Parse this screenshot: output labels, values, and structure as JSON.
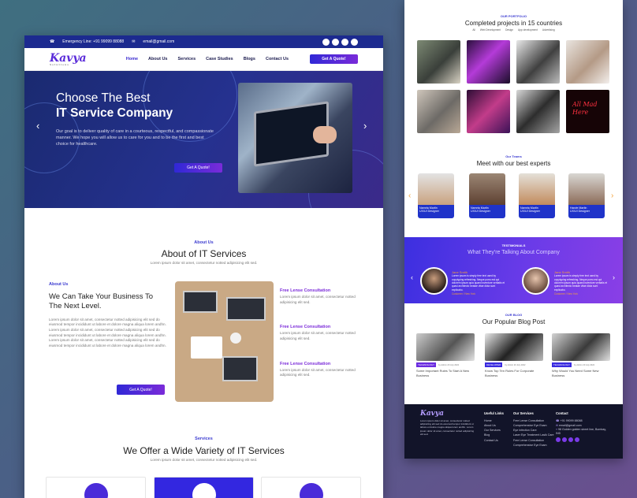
{
  "topbar": {
    "phone": "Emergency Line: +91 99099 88088",
    "email": "email@gmail.com"
  },
  "brand": {
    "name": "Kavya",
    "tagline": "Solutions"
  },
  "nav": {
    "items": [
      "Home",
      "About Us",
      "Services",
      "Case Studies",
      "Blogs",
      "Contact Us"
    ],
    "cta": "Get A Quote!"
  },
  "hero": {
    "line1": "Choose The Best",
    "line2": "IT Service Company",
    "body": "Our goal is to deliver quality of care in a courteous, respectful, and compassionate manner. We hope you will allow us to care for you and to be the first and best choice for healthcare.",
    "cta": "Get A Quote!"
  },
  "about": {
    "kicker": "About Us",
    "title": "About of IT Services",
    "sub": "Lorem ipsum dolor sit amet, consectetur notted adipisicing elit sed.",
    "label": "About Us",
    "heading": "We Can Take Your Business To The Next Level.",
    "para": "Lorem ipsum dolor sit amet, consectetur notted adipisicing elit sed do eiusmod tempor incididunt ut labore et dolore magna aliqua lorem andhn.",
    "para2": "Lorem ipsum dolor sit amet, consectetur notted adipisicing elit sed do eiusmod tempor incididunt ut labore et dolore magna aliqua lorem andhn. Lorem ipsum dolor sit amet, consectetur notted adipisicing elit sed do eiusmod tempor incididunt ut labore et dolore magna aliqua lorem andhn.",
    "cta": "Get A Quote!",
    "features": [
      {
        "title": "Free Lense Consultation",
        "text": "Lorem ipsum dolor sit amet, consectetur notted adipisicing elit sed."
      },
      {
        "title": "Free Lense Consultation",
        "text": "Lorem ipsum dolor sit amet, consectetur notted adipisicing elit sed."
      },
      {
        "title": "Free Lense Consultation",
        "text": "Lorem ipsum dolor sit amet, consectetur notted adipisicing elit sed."
      }
    ]
  },
  "services": {
    "kicker": "Services",
    "title": "We Offer a Wide Variety of IT Services",
    "sub": "Lorem ipsum dolor sit amet, consectetur notted adipisicing elit sed."
  },
  "portfolio": {
    "kicker": "OUR PORTFOLIO",
    "title": "Completed projects in 15 countries",
    "filters": [
      "All",
      "Web Development",
      "Design",
      "App development",
      "Advertising"
    ]
  },
  "team": {
    "kicker": "Our Teams",
    "title": "Meet with our best experts",
    "members": [
      {
        "name": "Namrta Martin",
        "role": "UX/UI Designer"
      },
      {
        "name": "Namrta Martin",
        "role": "UX/UI Designer"
      },
      {
        "name": "Namrta Martin",
        "role": "UX/UI Designer"
      },
      {
        "name": "Harvie Martin",
        "role": "UX/UI Designer"
      }
    ]
  },
  "testimonials": {
    "kicker": "TESTIMONIALS",
    "title": "What They're Talking About Company",
    "items": [
      {
        "name": "Jane Smith",
        "text": "Lorem ipsum is simply free text used by copytyping refreshing. Neque porro est qui dolorem ipsum quia quaed inventore veritatis et quasi architecto beatae vitae dicta sunt explicabo.",
        "role": "Customer / New York"
      },
      {
        "name": "Jane Smith",
        "text": "Lorem ipsum is simply free text used by copytyping refreshing. Neque porro est qui dolorem ipsum quia quaed inventore veritatis et quasi architecto beatae vitae dicta sunt explicabo.",
        "role": "Customer / New York"
      }
    ]
  },
  "blog": {
    "kicker": "OUR BLOG",
    "title": "Our Popular Blog Post",
    "posts": [
      {
        "tag": "TECHNOLOGY",
        "meta": "by Admin   20 July 2022",
        "title": "Some Important Rules To Start A New Business"
      },
      {
        "tag": "DEVELOPER",
        "meta": "by Admin   20 July 2022",
        "title": "Know Top Ten Rules For Corporate Business"
      },
      {
        "tag": "TECHNOLOGY",
        "meta": "by Admin   20 July 2022",
        "title": "Why Would You Need Some New Business"
      }
    ]
  },
  "footer": {
    "about": "Lorem ipsum dolor sit amet, consectetur notted adipisicing elit sed do eiusmod tempor incididunt ut labore et dolore magna aliqua lorem andhn. Lorem ipsum dolor sit amet, consectetur notted adipisicing elit sed.",
    "links_title": "Useful Links",
    "links": [
      "Home",
      "About Us",
      "Our Services",
      "Blog",
      "Contact Us"
    ],
    "services_title": "Our Services",
    "services": [
      "Free Lense Consultation",
      "Comprehensive Eye Exam",
      "Eye Infection Care",
      "Laser Eye Treatment Lasik Care",
      "Free Lense Consultation",
      "Comprehensive Eye Exam"
    ],
    "contact_title": "Contact",
    "phone": "+91 99099 88088",
    "email": "email@gmail.com",
    "address": "98 Golden golden street line, Bombay, IND"
  }
}
